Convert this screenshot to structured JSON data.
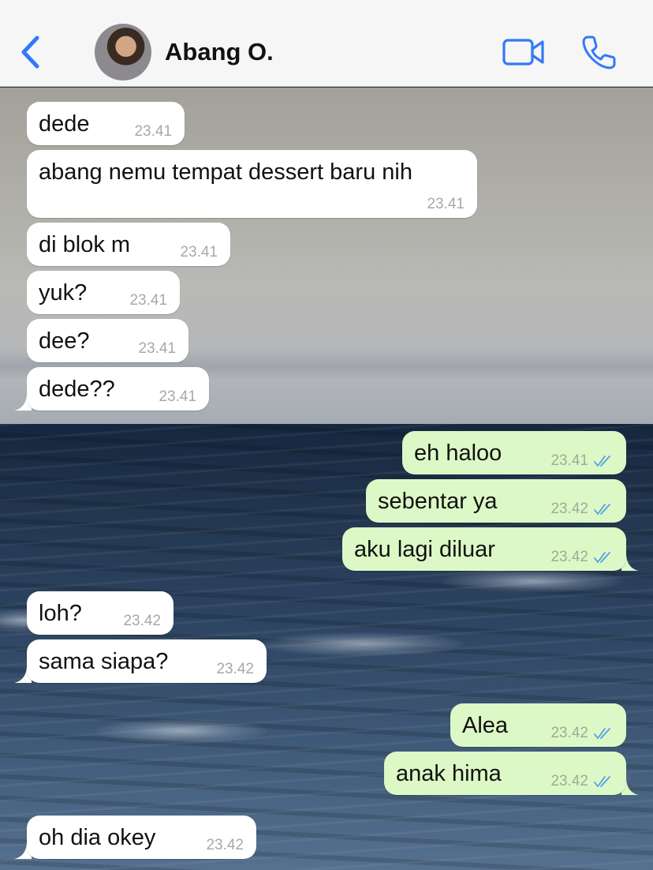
{
  "header": {
    "back_icon": "chevron-left-icon",
    "contact_name": "Abang O.",
    "video_icon": "video-camera-icon",
    "call_icon": "phone-icon",
    "accent_color": "#3478f6"
  },
  "messages": [
    {
      "direction": "in",
      "text": "dede",
      "time": "23.41"
    },
    {
      "direction": "in",
      "text": "abang nemu tempat dessert baru nih",
      "time": "23.41"
    },
    {
      "direction": "in",
      "text": "di blok m",
      "time": "23.41"
    },
    {
      "direction": "in",
      "text": "yuk?",
      "time": "23.41"
    },
    {
      "direction": "in",
      "text": "dee?",
      "time": "23.41"
    },
    {
      "direction": "in",
      "text": "dede??",
      "time": "23.41"
    },
    {
      "direction": "out",
      "text": "eh haloo",
      "time": "23.41",
      "status_icon": "double-check-icon"
    },
    {
      "direction": "out",
      "text": "sebentar ya",
      "time": "23.42",
      "status_icon": "double-check-icon"
    },
    {
      "direction": "out",
      "text": "aku lagi diluar",
      "time": "23.42",
      "status_icon": "double-check-icon"
    },
    {
      "direction": "in",
      "text": "loh?",
      "time": "23.42"
    },
    {
      "direction": "in",
      "text": "sama siapa?",
      "time": "23.42"
    },
    {
      "direction": "out",
      "text": "Alea",
      "time": "23.42",
      "status_icon": "double-check-icon"
    },
    {
      "direction": "out",
      "text": "anak hima",
      "time": "23.42",
      "status_icon": "double-check-icon"
    },
    {
      "direction": "in",
      "text": "oh dia okey",
      "time": "23.42"
    }
  ],
  "colors": {
    "incoming_bubble": "#ffffff",
    "outgoing_bubble": "#dcf8c6",
    "read_ticks": "#4fa3e6"
  }
}
